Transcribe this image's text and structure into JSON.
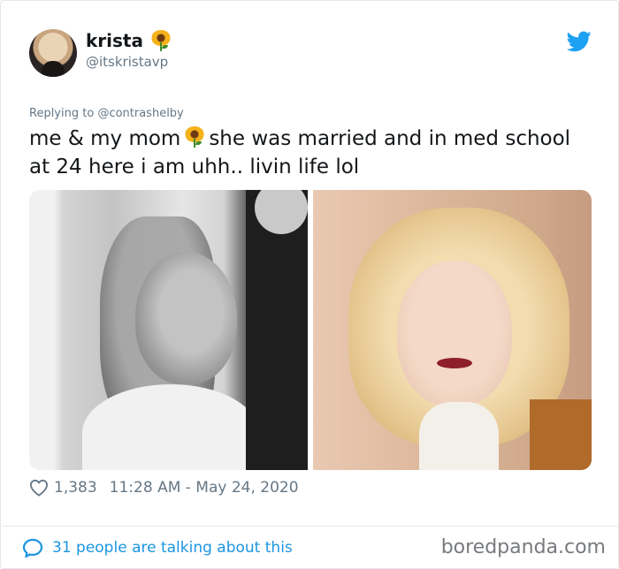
{
  "tweet": {
    "author_name": "krista",
    "author_emoji": "sunflower-icon",
    "handle": "@itskristavp",
    "replying_prefix": "Replying to",
    "replying_to": "@contrashelby",
    "text_part1": "me & my mom",
    "text_part2": "she was married and in med school at 24 here i am uhh.. livin life lol",
    "likes": "1,383",
    "timestamp": "11:28 AM - May 24, 2020",
    "talking": "31 people are talking about this"
  },
  "watermark": "boredpanda.com",
  "colors": {
    "twitter_blue": "#1da1f2",
    "link_blue": "#1b95e0",
    "muted_gray": "#657786",
    "text_dark": "#14171a"
  }
}
